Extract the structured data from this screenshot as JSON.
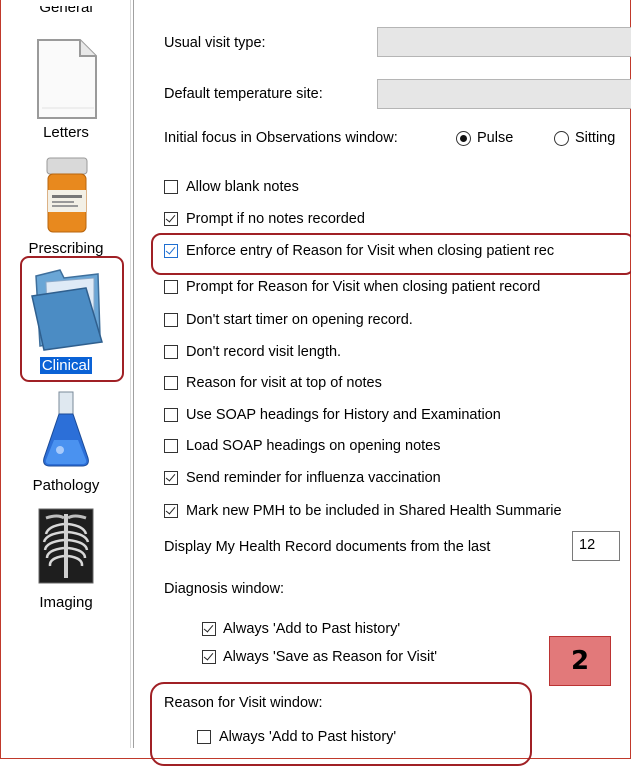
{
  "sidebar": {
    "items": [
      {
        "label": "General",
        "icon": "general-icon"
      },
      {
        "label": "Letters",
        "icon": "letters-document-icon"
      },
      {
        "label": "Prescribing",
        "icon": "pill-bottle-icon"
      },
      {
        "label": "Clinical",
        "icon": "clinical-folder-icon",
        "selected": true
      },
      {
        "label": "Pathology",
        "icon": "flask-icon"
      },
      {
        "label": "Imaging",
        "icon": "xray-icon"
      }
    ]
  },
  "settings": {
    "usual_visit_type_label": "Usual visit type:",
    "default_temp_site_label": "Default temperature site:",
    "initial_focus_label": "Initial focus in Observations window:",
    "initial_focus_options": [
      "Pulse",
      "Sitting"
    ],
    "checkboxes": [
      {
        "label": "Allow blank notes",
        "checked": false
      },
      {
        "label": "Prompt if no notes recorded",
        "checked": true
      },
      {
        "label": "Enforce entry of Reason for Visit when closing patient rec",
        "checked": true
      },
      {
        "label": "Prompt for Reason for Visit when closing patient record",
        "checked": false
      },
      {
        "label": "Don't start timer on opening record.",
        "checked": false
      },
      {
        "label": "Don't record visit length.",
        "checked": false
      },
      {
        "label": "Reason for visit at top of notes",
        "checked": false
      },
      {
        "label": "Use SOAP headings for History and Examination",
        "checked": false
      },
      {
        "label": "Load SOAP headings on opening notes",
        "checked": false
      },
      {
        "label": "Send reminder for influenza vaccination",
        "checked": true
      },
      {
        "label": "Mark new PMH to be included in Shared Health Summarie",
        "checked": true
      }
    ],
    "my_health_record_label": "Display My Health Record documents from the last",
    "my_health_record_value": "12",
    "diagnosis_window_label": "Diagnosis window:",
    "diagnosis_options": [
      {
        "label": "Always 'Add to Past history'",
        "checked": true
      },
      {
        "label": "Always 'Save as Reason for Visit'",
        "checked": true
      }
    ],
    "rfv_window_label": "Reason for Visit window:",
    "rfv_options": [
      {
        "label": "Always 'Add to Past history'",
        "checked": false
      }
    ]
  },
  "annotation": {
    "badge": "2",
    "highlight_color": "#a02025",
    "badge_color": "#e2797a"
  }
}
